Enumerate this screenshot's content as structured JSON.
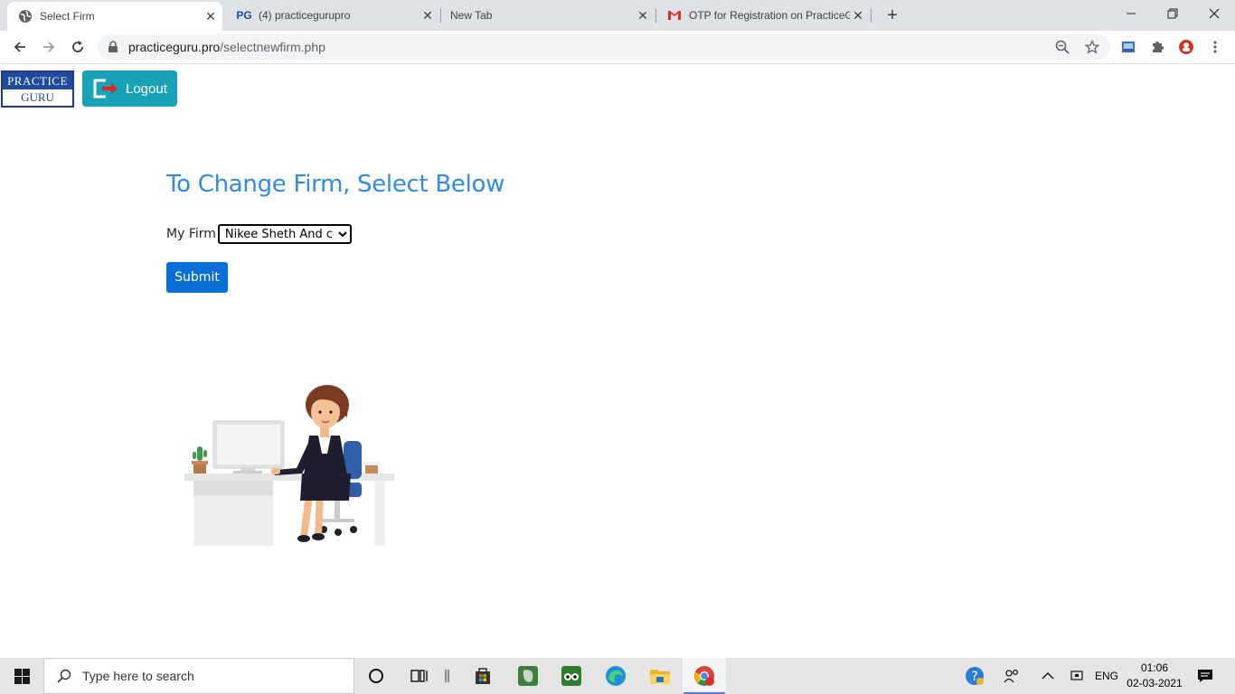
{
  "browser": {
    "tabs": [
      {
        "title": "Select Firm",
        "icon": "globe-icon",
        "active": true
      },
      {
        "title": "(4) practicegurupro",
        "icon": "pg-icon",
        "active": false
      },
      {
        "title": "New Tab",
        "icon": "none",
        "active": false
      },
      {
        "title": "OTP for Registration on PracticeG",
        "icon": "gmail-icon",
        "active": false
      }
    ],
    "new_tab_symbol": "+",
    "url_host": "practiceguru.pro",
    "url_path": "/selectnewfirm.php"
  },
  "header": {
    "logo_top": "PRACTICE",
    "logo_bottom": "GURU",
    "logout_label": "Logout"
  },
  "main": {
    "heading": "To Change Firm, Select Below",
    "firm_label": "My Firm",
    "firm_selected": "Nikee Sheth And co",
    "submit_label": "Submit"
  },
  "taskbar": {
    "search_placeholder": "Type here to search",
    "language": "ENG",
    "time": "01:06",
    "date": "02-03-2021"
  },
  "colors": {
    "heading": "#2f8be6",
    "logout_bg": "#17a2b8",
    "submit_bg": "#0b6fd8",
    "logo_blue": "#1f4a9e"
  }
}
